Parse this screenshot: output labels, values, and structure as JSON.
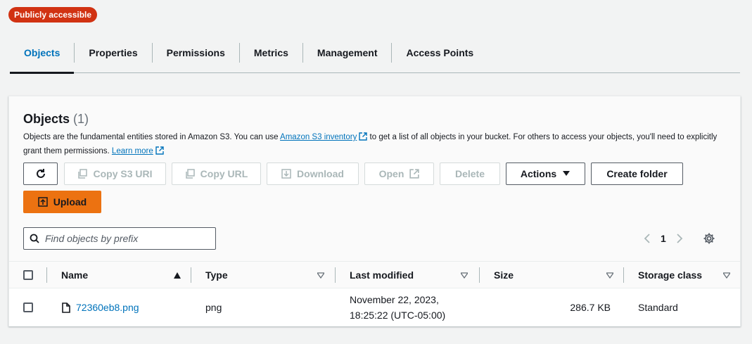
{
  "badge": "Publicly accessible",
  "tabs": [
    "Objects",
    "Properties",
    "Permissions",
    "Metrics",
    "Management",
    "Access Points"
  ],
  "panel": {
    "title": "Objects",
    "count": "(1)",
    "desc_part1": "Objects are the fundamental entities stored in Amazon S3. You can use ",
    "desc_link1": "Amazon S3 inventory",
    "desc_part2": " to get a list of all objects in your bucket. For others to access your objects, you'll need to explicitly grant them permissions. ",
    "desc_link2": "Learn more"
  },
  "buttons": {
    "copy_s3_uri": "Copy S3 URI",
    "copy_url": "Copy URL",
    "download": "Download",
    "open": "Open",
    "delete": "Delete",
    "actions": "Actions",
    "create_folder": "Create folder",
    "upload": "Upload"
  },
  "search": {
    "placeholder": "Find objects by prefix"
  },
  "pagination": {
    "page": "1"
  },
  "table": {
    "columns": [
      "Name",
      "Type",
      "Last modified",
      "Size",
      "Storage class"
    ],
    "rows": [
      {
        "name": "72360eb8.png",
        "type": "png",
        "modified_line1": "November 22, 2023,",
        "modified_line2": "18:25:22 (UTC-05:00)",
        "size": "286.7 KB",
        "storage_class": "Standard"
      }
    ]
  },
  "colors": {
    "link": "#0073bb",
    "badge": "#d13212",
    "primary": "#ec7211"
  }
}
